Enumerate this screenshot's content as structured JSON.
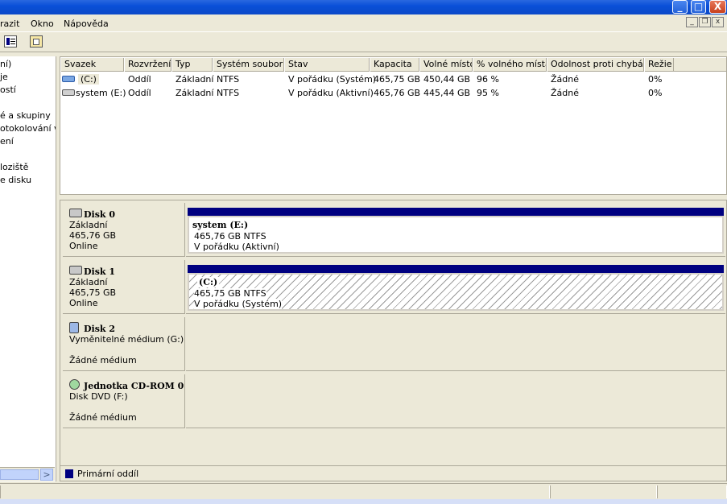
{
  "menu": {
    "items": [
      "razit",
      "Okno",
      "Nápověda"
    ]
  },
  "window_controls": {
    "minimize": "_",
    "maximize": "□",
    "close": "X"
  },
  "mdi_controls": {
    "minimize": "_",
    "restore": "❐",
    "close": "x"
  },
  "tree": {
    "items": [
      "ní)",
      "je",
      "ostí",
      "",
      "é a skupiny",
      "otokolování vý",
      "ení",
      "",
      "loziště",
      "e disku"
    ]
  },
  "volumes": {
    "headers": [
      "Svazek",
      "Rozvržení",
      "Typ",
      "Systém souborů",
      "Stav",
      "Kapacita",
      "Volné místo",
      "% volného místa",
      "Odolnost proti chybám",
      "Režie"
    ],
    "rows": [
      [
        "(C:)",
        "Oddíl",
        "Základní",
        "NTFS",
        "V pořádku (Systém)",
        "465,75 GB",
        "450,44 GB",
        "96 %",
        "Žádné",
        "0%"
      ],
      [
        "system (E:)",
        "Oddíl",
        "Základní",
        "NTFS",
        "V pořádku (Aktivní)",
        "465,76 GB",
        "445,44 GB",
        "95 %",
        "Žádné",
        "0%"
      ]
    ]
  },
  "disks": [
    {
      "title": "Disk 0",
      "line1": "Základní",
      "line2": "465,76 GB",
      "line3": "Online",
      "partition": {
        "name": "system  (E:)",
        "size": "465,76 GB NTFS",
        "status": "V pořádku (Aktivní)"
      }
    },
    {
      "title": "Disk 1",
      "line1": "Základní",
      "line2": "465,75 GB",
      "line3": "Online",
      "partition": {
        "name": "(C:)",
        "size": "465,75 GB NTFS",
        "status": "V pořádku (Systém)"
      }
    },
    {
      "title": "Disk 2",
      "line1": "Vyměnitelné médium (G:)",
      "line2": "",
      "line3": "Žádné médium"
    },
    {
      "title": "Jednotka CD-ROM 0",
      "line1": "Disk DVD (F:)",
      "line2": "",
      "line3": "Žádné médium"
    }
  ],
  "legend": {
    "label": "Primární oddíl",
    "color": "#000080"
  },
  "scroll": {
    "right_arrow": ">"
  }
}
